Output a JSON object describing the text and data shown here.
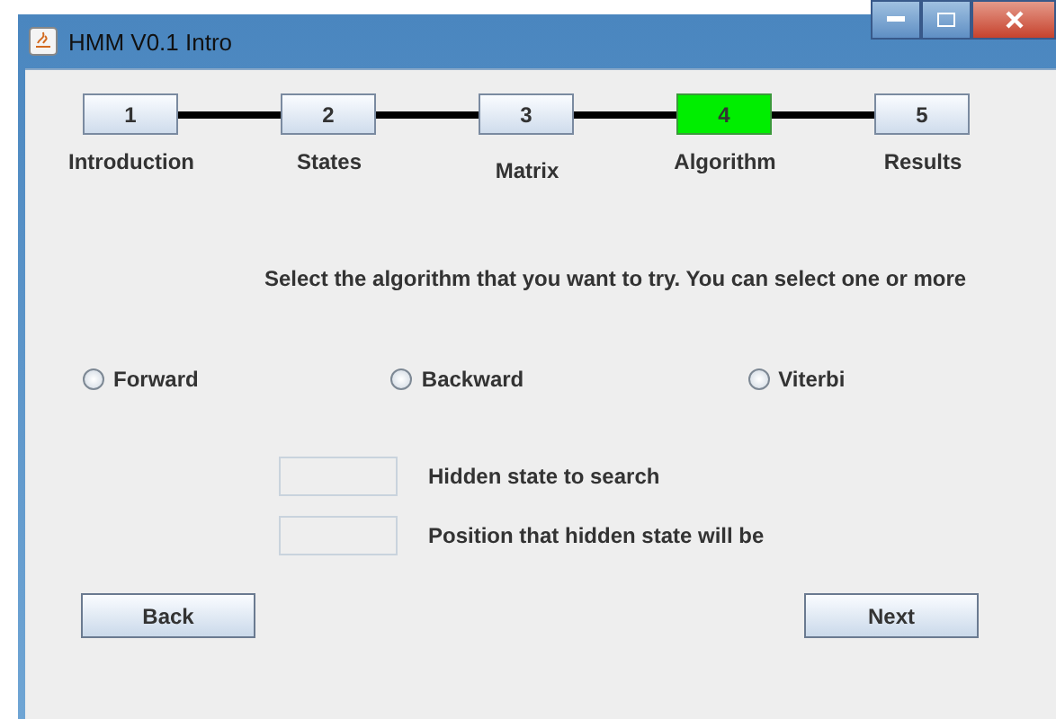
{
  "window": {
    "title": "HMM V0.1 Intro"
  },
  "steps": [
    {
      "number": "1",
      "label": "Introduction",
      "selected": false
    },
    {
      "number": "2",
      "label": "States",
      "selected": false
    },
    {
      "number": "3",
      "label": "Matrix",
      "selected": false
    },
    {
      "number": "4",
      "label": "Algorithm",
      "selected": true
    },
    {
      "number": "5",
      "label": "Results",
      "selected": false
    }
  ],
  "instruction": "Select the algorithm that you want to try. You can select one or more",
  "algorithms": [
    {
      "label": "Forward",
      "checked": false
    },
    {
      "label": "Backward",
      "checked": false
    },
    {
      "label": "Viterbi",
      "checked": false
    }
  ],
  "fields": [
    {
      "label": "Hidden state to search"
    },
    {
      "label": "Position that hidden state will be"
    }
  ],
  "buttons": [
    "Back",
    "Next"
  ]
}
